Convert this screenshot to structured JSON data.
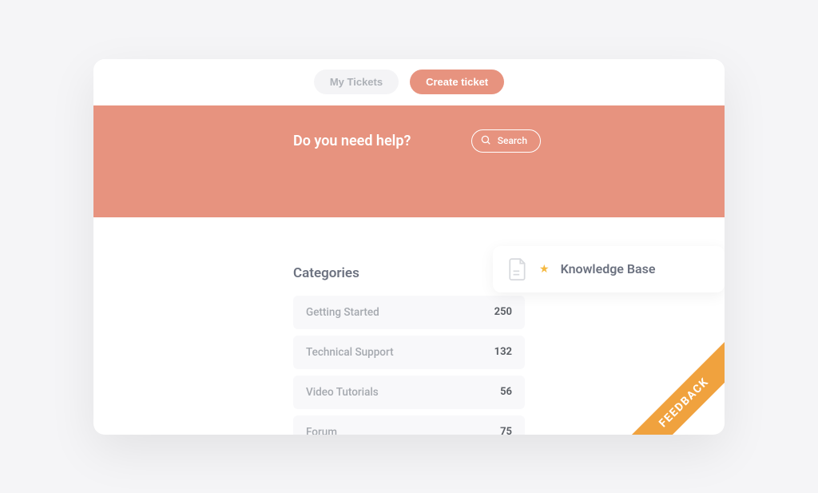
{
  "nav": {
    "my_tickets": "My Tickets",
    "create_ticket": "Create ticket"
  },
  "hero": {
    "title": "Do you need help?",
    "search_label": "Search"
  },
  "kb": {
    "title": "Knowledge Base"
  },
  "categories": {
    "title": "Categories",
    "items": [
      {
        "name": "Getting Started",
        "count": "250"
      },
      {
        "name": "Technical Support",
        "count": "132"
      },
      {
        "name": "Video Tutorials",
        "count": "56"
      },
      {
        "name": "Forum",
        "count": "75"
      }
    ]
  },
  "feedback": {
    "label": "FEEDBACK"
  },
  "colors": {
    "accent": "#e7937f",
    "feedback": "#f0a23e",
    "star": "#f5b940"
  }
}
